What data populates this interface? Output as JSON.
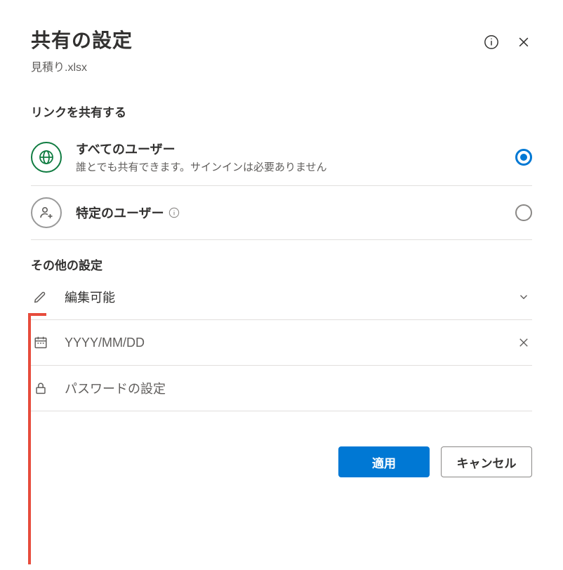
{
  "header": {
    "title": "共有の設定",
    "filename": "見積り.xlsx"
  },
  "share": {
    "section_label": "リンクを共有する",
    "options": [
      {
        "title": "すべてのユーザー",
        "subtitle": "誰とでも共有できます。サインインは必要ありません",
        "selected": true
      },
      {
        "title": "特定のユーザー",
        "subtitle": "",
        "selected": false
      }
    ]
  },
  "other": {
    "section_label": "その他の設定",
    "permission_label": "編集可能",
    "date_placeholder": "YYYY/MM/DD",
    "password_placeholder": "パスワードの設定"
  },
  "footer": {
    "apply": "適用",
    "cancel": "キャンセル"
  }
}
